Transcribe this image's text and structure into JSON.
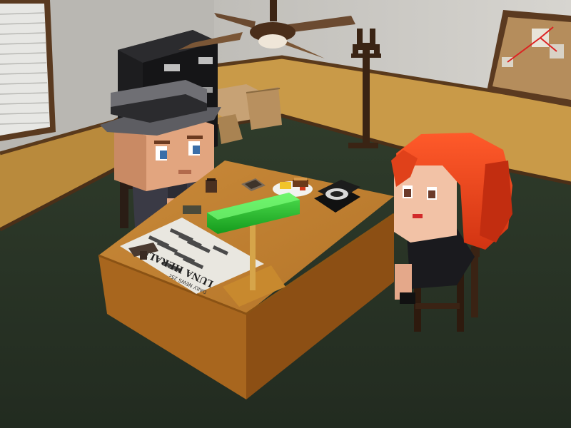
{
  "scene": {
    "newspaper": {
      "masthead": "LUNA HERALD",
      "dateline": "DAILY NEWS 25c"
    }
  }
}
